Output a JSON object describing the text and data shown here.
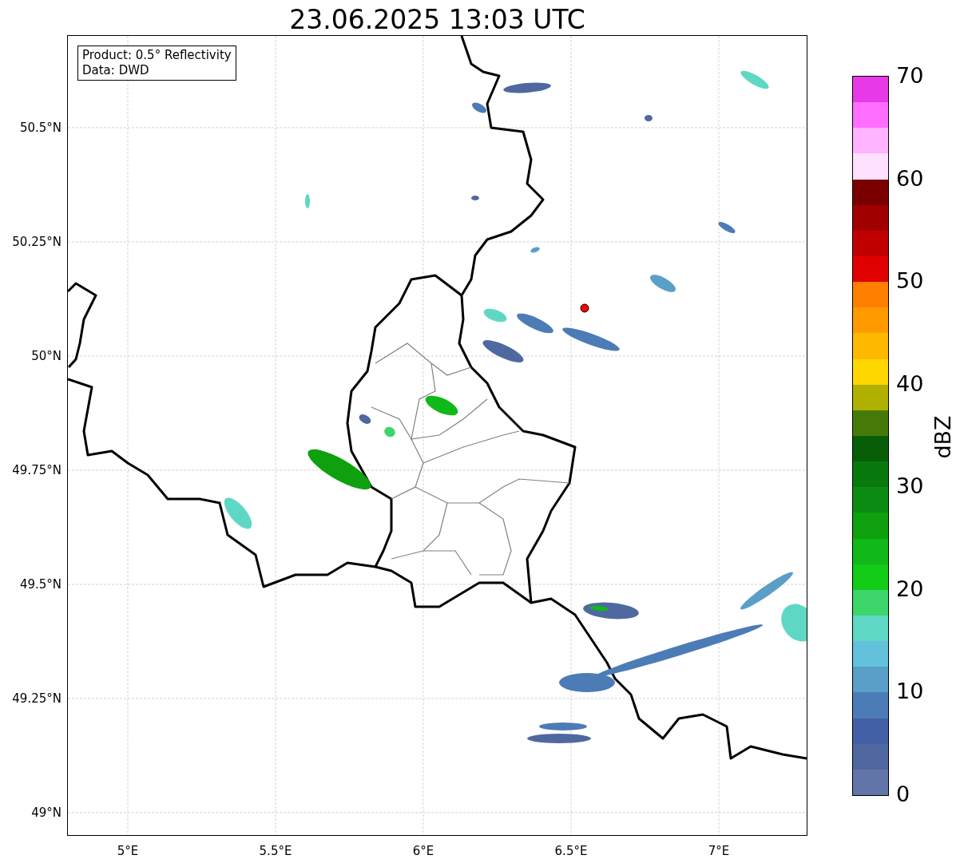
{
  "title": "23.06.2025 13:03 UTC",
  "legend": [
    "Product: 0.5° Reflectivity",
    "Data: DWD"
  ],
  "y_ticks": [
    "50.5°N",
    "50.25°N",
    "50°N",
    "49.75°N",
    "49.5°N",
    "49.25°N",
    "49°N"
  ],
  "x_ticks": [
    "5°E",
    "5.5°E",
    "6°E",
    "6.5°E",
    "7°E"
  ],
  "colorbar": {
    "label": "dBZ",
    "ticks": [
      "70",
      "60",
      "50",
      "40",
      "30",
      "20",
      "10",
      "0"
    ],
    "segments": [
      {
        "color": "#e83ae8"
      },
      {
        "color": "#ff6eff"
      },
      {
        "color": "#ffb3ff"
      },
      {
        "color": "#ffe0ff"
      },
      {
        "color": "#7a0000"
      },
      {
        "color": "#a00000"
      },
      {
        "color": "#c00000"
      },
      {
        "color": "#e00000"
      },
      {
        "color": "#ff7f00"
      },
      {
        "color": "#ff9900"
      },
      {
        "color": "#ffb800"
      },
      {
        "color": "#ffd700"
      },
      {
        "color": "#b0b000"
      },
      {
        "color": "#457a08"
      },
      {
        "color": "#075e07"
      },
      {
        "color": "#087a0d"
      },
      {
        "color": "#0b8b11"
      },
      {
        "color": "#0ea00e"
      },
      {
        "color": "#10b81a"
      },
      {
        "color": "#12cc17"
      },
      {
        "color": "#3dd66b"
      },
      {
        "color": "#5ed8c5"
      },
      {
        "color": "#63c1dc"
      },
      {
        "color": "#5a9fc7"
      },
      {
        "color": "#4c7cb5"
      },
      {
        "color": "#435fa5"
      },
      {
        "color": "#5068a0"
      },
      {
        "color": "#6374a8"
      }
    ]
  }
}
